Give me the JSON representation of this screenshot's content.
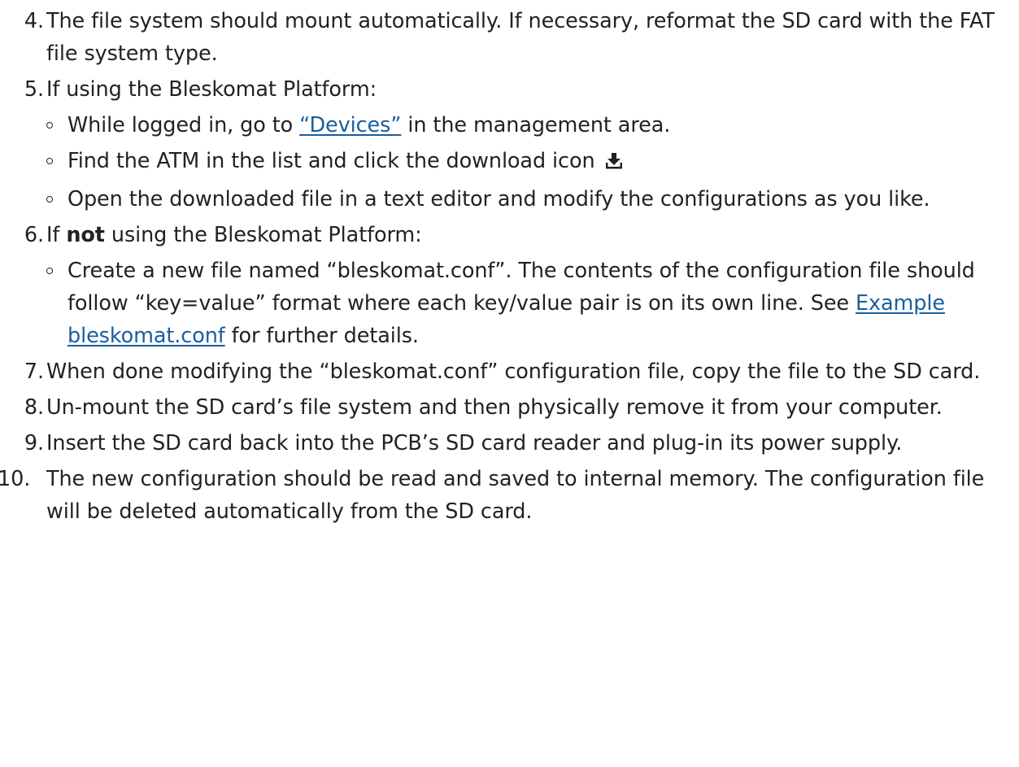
{
  "steps": [
    {
      "num": "4.",
      "text": "The file system should mount automatically. If necessary, reformat the SD card with the FAT file system type."
    },
    {
      "num": "5.",
      "text": "If using the Bleskomat Platform:",
      "sub": [
        {
          "before": "While logged in, go to ",
          "link": "“Devices”",
          "after": " in the management area."
        },
        {
          "text": "Find the ATM in the list and click the download icon",
          "icon": "download-icon"
        },
        {
          "text": "Open the downloaded file in a text editor and modify the configurations as you like."
        }
      ]
    },
    {
      "num": "6.",
      "before": "If ",
      "bold": "not",
      "after": " using the Bleskomat Platform:",
      "sub": [
        {
          "before": "Create a new file named “bleskomat.conf”. The contents of the configuration file should follow “key=value” format where each key/value pair is on its own line. See ",
          "link": "Example bleskomat.conf",
          "after": " for further details."
        }
      ]
    },
    {
      "num": "7.",
      "text": "When done modifying the “bleskomat.conf” configuration file, copy the file to the SD card."
    },
    {
      "num": "8.",
      "text": "Un-mount the SD card’s file system and then physically remove it from your computer."
    },
    {
      "num": "9.",
      "text": "Insert the SD card back into the PCB’s SD card reader and plug-in its power supply."
    },
    {
      "num": "10.",
      "text": "The new configuration should be read and saved to internal memory. The configuration file will be deleted automatically from the SD card."
    }
  ],
  "colors": {
    "text": "#222222",
    "link": "#1a5f9e"
  }
}
